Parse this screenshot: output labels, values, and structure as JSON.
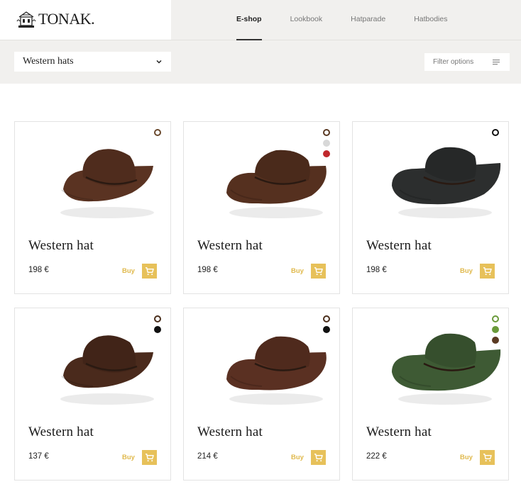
{
  "brand": {
    "name": "TONAK."
  },
  "nav": [
    {
      "label": "E-shop",
      "active": true
    },
    {
      "label": "Lookbook",
      "active": false
    },
    {
      "label": "Hatparade",
      "active": false
    },
    {
      "label": "Hatbodies",
      "active": false
    }
  ],
  "category": {
    "selected": "Western hats"
  },
  "filter": {
    "label": "Filter options"
  },
  "colors": {
    "accent": "#e7c15a",
    "accent_text": "#e0b94c"
  },
  "products": [
    {
      "name": "Western hat",
      "price": "198 €",
      "buy": "Buy",
      "hat_color": "#5a3322",
      "swatches": [
        "#6b4a2e"
      ]
    },
    {
      "name": "Western hat",
      "price": "198 €",
      "buy": "Buy",
      "hat_color": "#55301f",
      "swatches": [
        "#5a3a24",
        "#d8d8d8",
        "#c0282c"
      ]
    },
    {
      "name": "Western hat",
      "price": "198 €",
      "buy": "Buy",
      "hat_color": "#2c2e2e",
      "swatches": [
        "#111111"
      ]
    },
    {
      "name": "Western hat",
      "price": "137 €",
      "buy": "Buy",
      "hat_color": "#4a2a1c",
      "swatches": [
        "#4a2e1c",
        "#111111"
      ]
    },
    {
      "name": "Western hat",
      "price": "214 €",
      "buy": "Buy",
      "hat_color": "#5a3022",
      "swatches": [
        "#4a2e1c",
        "#111111"
      ]
    },
    {
      "name": "Western hat",
      "price": "222 €",
      "buy": "Buy",
      "hat_color": "#3e5a34",
      "swatches": [
        "#6a9a3a",
        "#6a9a3a",
        "#5a3a22"
      ]
    }
  ]
}
